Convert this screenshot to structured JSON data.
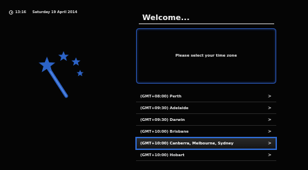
{
  "status": {
    "time": "13:16",
    "date": "Saturday 19 April 2014"
  },
  "wizard": {
    "title": "Welcome...",
    "message": "Please select your time zone",
    "icon": "magic-wand-icon",
    "accent_color": "#2f6ad0"
  },
  "timezones": [
    {
      "label": "(GMT+08:00) Perth",
      "arrow": ">"
    },
    {
      "label": "(GMT+09:30) Adelaide",
      "arrow": ">"
    },
    {
      "label": "(GMT+09:30) Darwin",
      "arrow": ">"
    },
    {
      "label": "(GMT+10:00) Brisbane",
      "arrow": ">"
    },
    {
      "label": "(GMT+10:00) Canberra, Melbourne, Sydney",
      "arrow": ">",
      "selected": true
    },
    {
      "label": "(GMT+10:00) Hobart",
      "arrow": ">"
    }
  ]
}
